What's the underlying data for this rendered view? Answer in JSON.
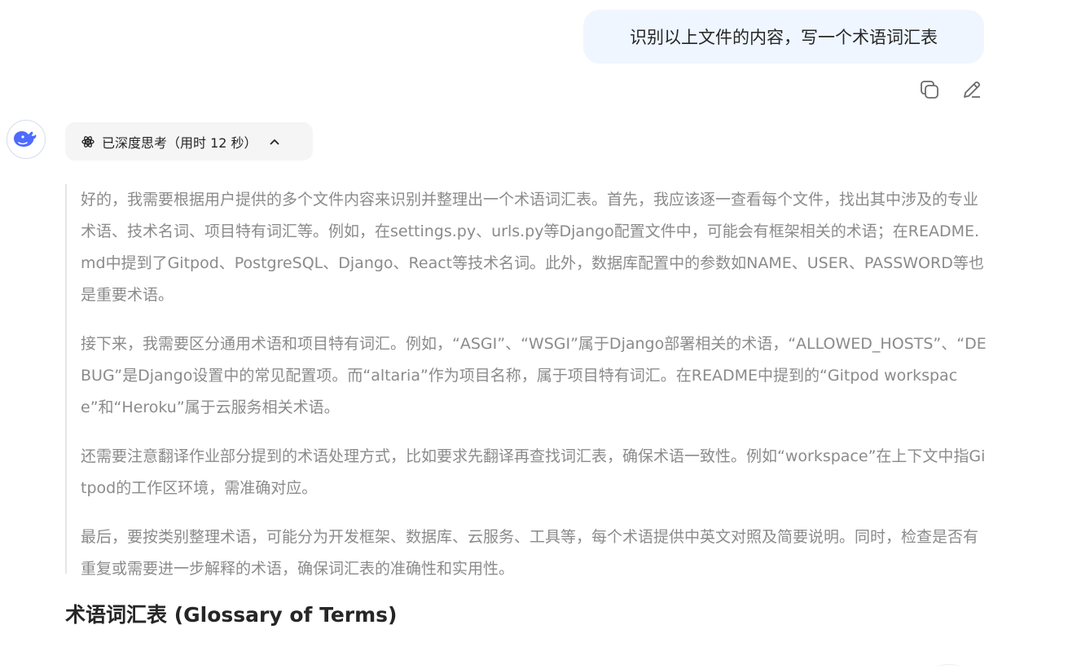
{
  "user_message": {
    "text": "识别以上文件的内容，写一个术语词汇表"
  },
  "message_actions": {
    "copy_icon": "copy-icon",
    "edit_icon": "edit-icon"
  },
  "assistant": {
    "avatar_icon": "deepseek-whale-icon",
    "thinking_toggle": {
      "label": "已深度思考（用时 12 秒）",
      "state": "expanded",
      "icon": "atom-icon",
      "chevron": "chevron-up-icon"
    },
    "thinking_paragraphs": [
      "好的，我需要根据用户提供的多个文件内容来识别并整理出一个术语词汇表。首先，我应该逐一查看每个文件，找出其中涉及的专业术语、技术名词、项目特有词汇等。例如，在settings.py、urls.py等Django配置文件中，可能会有框架相关的术语；在README.md中提到了Gitpod、PostgreSQL、Django、React等技术名词。此外，数据库配置中的参数如NAME、USER、PASSWORD等也是重要术语。",
      "接下来，我需要区分通用术语和项目特有词汇。例如，“ASGI”、“WSGI”属于Django部署相关的术语，“ALLOWED_HOSTS”、“DEBUG”是Django设置中的常见配置项。而“altaria”作为项目名称，属于项目特有词汇。在README中提到的“Gitpod workspace”和“Heroku”属于云服务相关术语。",
      "还需要注意翻译作业部分提到的术语处理方式，比如要求先翻译再查找词汇表，确保术语一致性。例如“workspace”在上下文中指Gitpod的工作区环境，需准确对应。",
      "最后，要按类别整理术语，可能分为开发框架、数据库、云服务、工具等，每个术语提供中英文对照及简要说明。同时，检查是否有重复或需要进一步解释的术语，确保词汇表的准确性和实用性。"
    ],
    "answer_heading": "术语词汇表 (Glossary of Terms)"
  },
  "colors": {
    "user_bubble_bg": "#eff6ff",
    "thinking_text": "#8b8b8b",
    "accent_blue": "#4d6bfe",
    "toggle_bg": "#f5f5f5"
  }
}
